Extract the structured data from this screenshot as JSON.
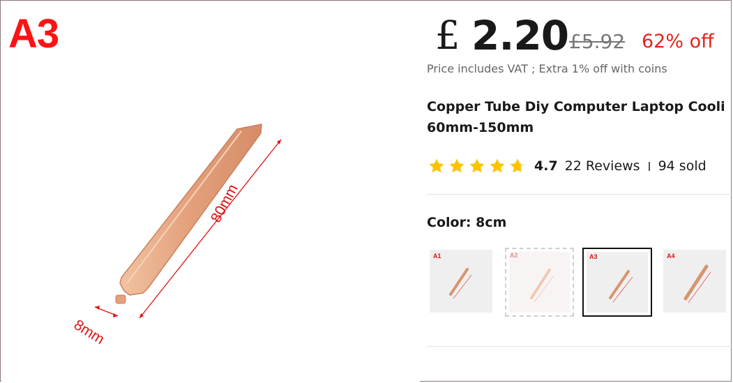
{
  "main_image": {
    "variant_mark": "A3",
    "dimension_length": "80mm",
    "dimension_width": "8mm"
  },
  "price": {
    "currency_symbol": "£",
    "amount": "2.20",
    "original": "£5.92",
    "discount": "62% off",
    "vat_note": "Price includes VAT ; Extra 1% off with coins"
  },
  "product": {
    "title_line1": "Copper Tube Diy Computer Laptop Cooli",
    "title_line2": "60mm-150mm"
  },
  "rating": {
    "value": "4.7",
    "stars": 4.7,
    "reviews": "22 Reviews",
    "sold": "94 sold"
  },
  "color": {
    "label": "Color: 8cm",
    "options": [
      {
        "tag": "A1",
        "selected": false
      },
      {
        "tag": "A2",
        "selected": false
      },
      {
        "tag": "A3",
        "selected": true
      },
      {
        "tag": "A4",
        "selected": false
      }
    ]
  },
  "colors": {
    "accent_red": "#e1251b",
    "star_yellow": "#fdc300",
    "copper": "#e7a77f"
  }
}
